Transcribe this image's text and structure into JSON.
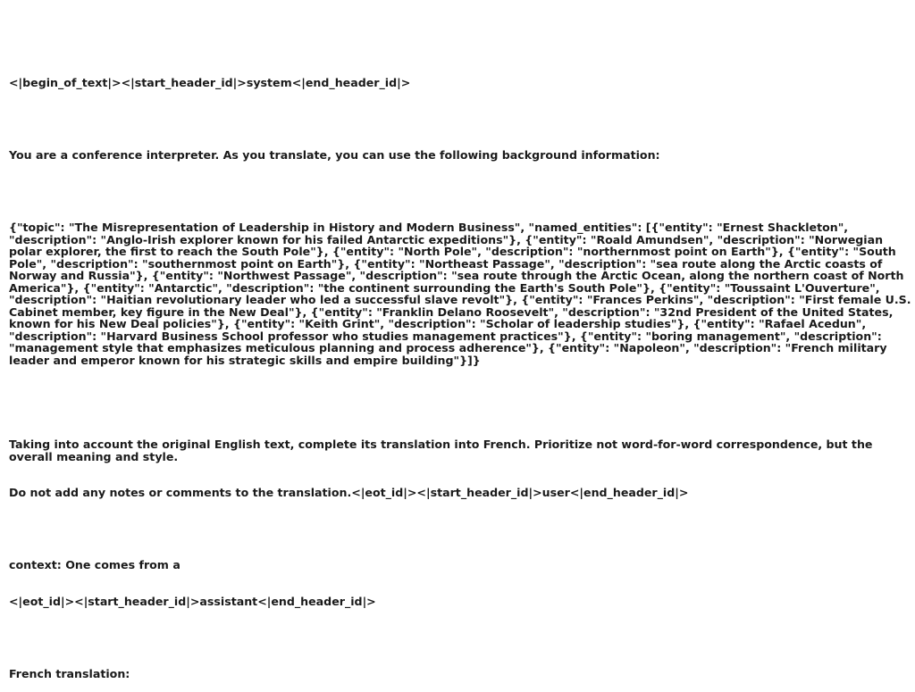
{
  "document": {
    "header_system": "<|begin_of_text|><|start_header_id|>system<|end_header_id|>",
    "system_intro": "You are a conference interpreter. As you translate, you can use the following background information:",
    "background_json": "{\"topic\": \"The Misrepresentation of Leadership in History and Modern Business\", \"named_entities\": [{\"entity\": \"Ernest Shackleton\", \"description\": \"Anglo-Irish explorer known for his failed Antarctic expeditions\"}, {\"entity\": \"Roald Amundsen\", \"description\": \"Norwegian polar explorer, the first to reach the South Pole\"}, {\"entity\": \"North Pole\", \"description\": \"northernmost point on Earth\"}, {\"entity\": \"South Pole\", \"description\": \"southernmost point on Earth\"}, {\"entity\": \"Northeast Passage\", \"description\": \"sea route along the Arctic coasts of Norway and Russia\"}, {\"entity\": \"Northwest Passage\", \"description\": \"sea route through the Arctic Ocean, along the northern coast of North America\"}, {\"entity\": \"Antarctic\", \"description\": \"the continent surrounding the Earth's South Pole\"}, {\"entity\": \"Toussaint L'Ouverture\", \"description\": \"Haitian revolutionary leader who led a successful slave revolt\"}, {\"entity\": \"Frances Perkins\", \"description\": \"First female U.S. Cabinet member, key figure in the New Deal\"}, {\"entity\": \"Franklin Delano Roosevelt\", \"description\": \"32nd President of the United States, known for his New Deal policies\"}, {\"entity\": \"Keith Grint\", \"description\": \"Scholar of leadership studies\"}, {\"entity\": \"Rafael Acedun\", \"description\": \"Harvard Business School professor who studies management practices\"}, {\"entity\": \"boring management\", \"description\": \"management style that emphasizes meticulous planning and process adherence\"}, {\"entity\": \"Napoleon\", \"description\": \"French military leader and emperor known for his strategic skills and empire building\"}]}",
    "instruction_line1": "Taking into account the original English text, complete its translation into French. Prioritize not word-for-word correspondence, but the overall meaning and style.",
    "instruction_line2": "Do not add any notes or comments to the translation.<|eot_id|><|start_header_id|>user<|end_header_id|>",
    "context_line": "context: One comes from a",
    "assistant_header": "<|eot_id|><|start_header_id|>assistant<|end_header_id|>",
    "french_label": "French translation:"
  }
}
